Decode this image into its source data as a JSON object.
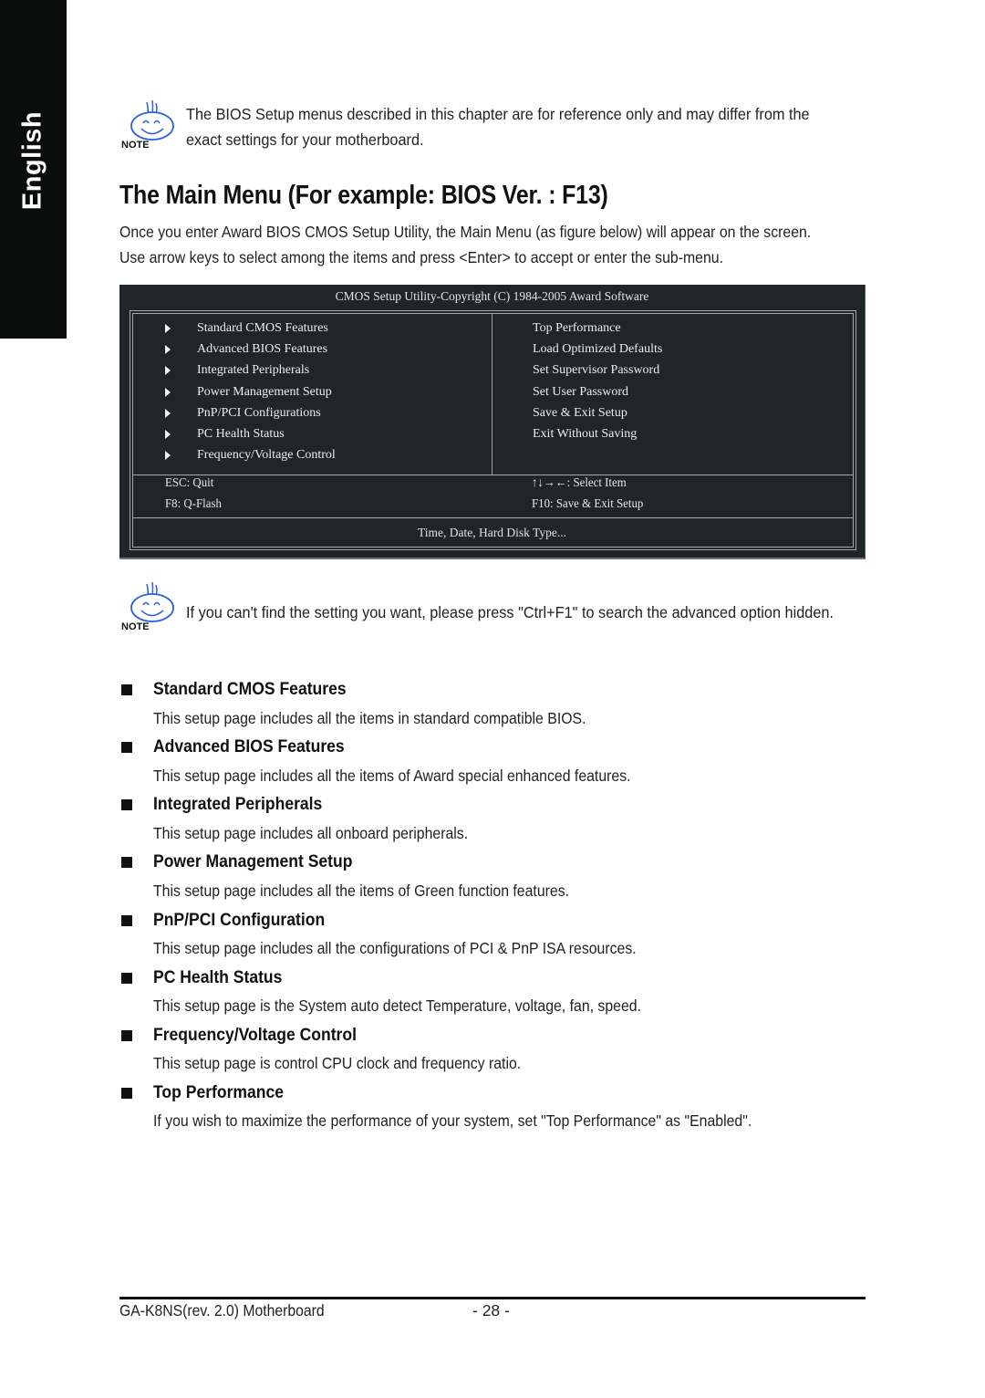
{
  "side_tab": {
    "label": "English"
  },
  "notes": [
    {
      "icon": "smiley-note-icon",
      "badge": "NOTE",
      "lines": [
        "The BIOS Setup menus described in this chapter are for reference only and may differ from the",
        "exact settings for your motherboard."
      ]
    },
    {
      "icon": "smiley-note-icon",
      "badge": "NOTE",
      "lines": [
        "If you can't find the setting you want, please press \"Ctrl+F1\" to search the advanced option hidden."
      ]
    }
  ],
  "title": "The Main Menu (For example: BIOS Ver. : F13)",
  "intro": [
    "Once you enter Award BIOS CMOS Setup Utility, the Main Menu (as figure below) will appear on the screen.",
    "Use arrow keys to select among the items and press <Enter> to accept or enter the sub-menu."
  ],
  "bios_screen": {
    "title": "CMOS Setup Utility-Copyright (C) 1984-2005 Award Software",
    "left_menu": [
      "Standard CMOS Features",
      "Advanced BIOS Features",
      "Integrated Peripherals",
      "Power Management Setup",
      "PnP/PCI Configurations",
      "PC Health Status",
      "Frequency/Voltage Control"
    ],
    "right_menu": [
      "Top Performance",
      "Load Optimized Defaults",
      "Set Supervisor Password",
      "Set User Password",
      "Save & Exit Setup",
      "Exit Without Saving"
    ],
    "keys": {
      "esc": "ESC: Quit",
      "f8": "F8: Q-Flash",
      "arrows": "↑↓→←: Select Item",
      "f10": "F10: Save & Exit Setup"
    },
    "help_line": "Time, Date, Hard Disk Type..."
  },
  "sections": [
    {
      "heading": "Standard CMOS Features",
      "description": "This setup page includes all the items in standard compatible BIOS."
    },
    {
      "heading": "Advanced BIOS Features",
      "description": "This setup page includes all the items of Award special enhanced features."
    },
    {
      "heading": "Integrated Peripherals",
      "description": "This setup page includes all onboard peripherals."
    },
    {
      "heading": "Power Management Setup",
      "description": "This setup page includes all the items of Green function features."
    },
    {
      "heading": "PnP/PCI Configuration",
      "description": "This setup page includes all the configurations of PCI & PnP ISA resources."
    },
    {
      "heading": "PC Health Status",
      "description": "This setup page is the System auto detect Temperature, voltage, fan, speed."
    },
    {
      "heading": "Frequency/Voltage Control",
      "description": "This setup page is control CPU clock and frequency ratio."
    },
    {
      "heading": "Top Performance",
      "description": "If you wish to maximize the performance of your system, set \"Top Performance\" as \"Enabled\"."
    }
  ],
  "footer": {
    "product": "GA-K8NS(rev. 2.0) Motherboard",
    "page": "- 28 -"
  },
  "colors": {
    "bios_background": "#222527",
    "bios_text": "#e8e8e8",
    "note_icon": "#2a5fe0",
    "side_tab": "#0b0c0c"
  }
}
